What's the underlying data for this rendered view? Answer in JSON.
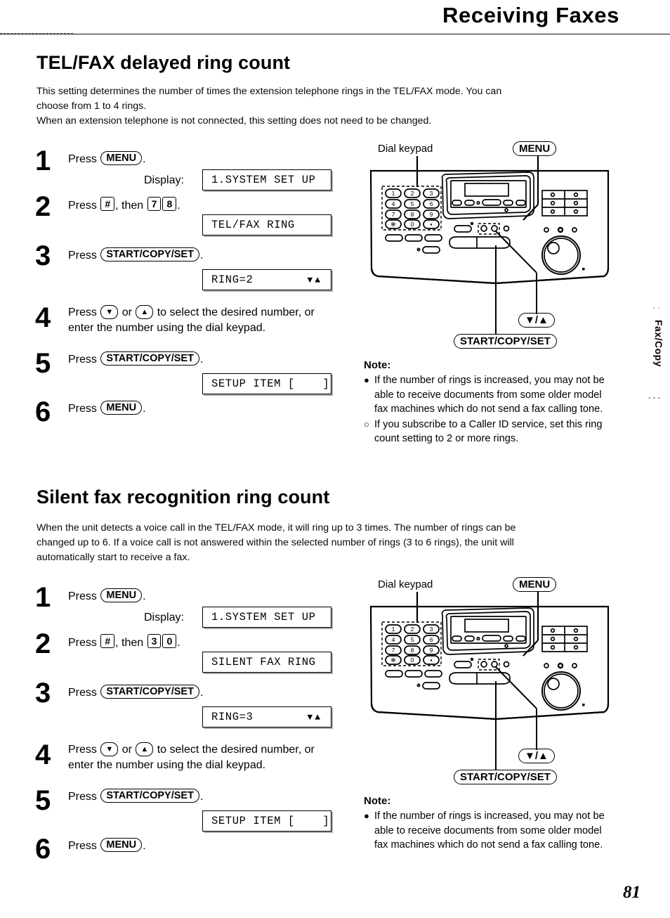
{
  "header": {
    "title": "Receiving Faxes"
  },
  "page_number": "81",
  "side_tab": "Fax/Copy",
  "sections": [
    {
      "title": "TEL/FAX delayed ring count",
      "body": "This setting determines the number of times the extension telephone rings in the TEL/FAX mode. You can choose from 1 to 4 rings.\nWhen an extension telephone is not connected, this setting does not need to be changed.",
      "body_line1": "This setting determines the number of times the extension telephone rings in the TEL/FAX mode. You can",
      "body_line2": "choose from 1 to 4 rings.",
      "body_line3": "When an extension telephone is not connected, this setting does not need to be changed.",
      "steps": [
        {
          "num": "1",
          "press_label": "Press",
          "key": "MENU",
          "suffix": "."
        },
        {
          "num": "2",
          "press_label": "Press",
          "key": "#",
          "mid": ", then",
          "key2": "7",
          "key3": "8",
          "suffix": "."
        },
        {
          "num": "3",
          "press_label": "Press",
          "key": "START/COPY/SET",
          "suffix": "."
        },
        {
          "num": "4",
          "press_label": "Press",
          "key": "▼",
          "mid": "or",
          "key2": "▲",
          "text_after": "to select the desired number, or",
          "text_line2": "enter the number using the dial keypad."
        },
        {
          "num": "5",
          "press_label": "Press",
          "key": "START/COPY/SET",
          "suffix": "."
        },
        {
          "num": "6",
          "press_label": "Press",
          "key": "MENU",
          "suffix": "."
        }
      ],
      "display_label": "Display:",
      "lcds": [
        {
          "text": "1.SYSTEM SET UP",
          "right": ""
        },
        {
          "text": "TEL/FAX RING",
          "right": ""
        },
        {
          "text": "RING=2",
          "right": "▼▲"
        },
        {
          "text": "SETUP ITEM [    ]",
          "right": ""
        }
      ],
      "diagram": {
        "keypad_label": "Dial keypad",
        "menu_label": "MENU",
        "arrows_label_down": "▼",
        "arrows_label_sep": "/",
        "arrows_label_up": "▲",
        "start_label": "START/COPY/SET",
        "keypad_keys": [
          "1",
          "2",
          "3",
          "4",
          "5",
          "6",
          "7",
          "8",
          "9",
          "∗",
          "0",
          "■"
        ]
      },
      "note": {
        "head": "Note:",
        "items": [
          "If the number of rings is increased, you may not be able to receive documents from some older model fax machines which do not send a fax calling tone.",
          "If you subscribe to a Caller ID service, set this ring count setting to 2 or more rings."
        ],
        "bullets": [
          "●",
          "○"
        ]
      }
    },
    {
      "title": "Silent fax recognition ring count",
      "body_line1": "When the unit detects a voice call in the TEL/FAX mode, it will ring up to 3 times. The number of rings can be",
      "body_line2": "changed up to 6. If a voice call is not answered within the selected number of rings (3 to 6 rings), the unit will",
      "body_line3": "automatically start to receive a fax.",
      "steps": [
        {
          "num": "1",
          "press_label": "Press",
          "key": "MENU",
          "suffix": "."
        },
        {
          "num": "2",
          "press_label": "Press",
          "key": "#",
          "mid": ", then",
          "key2": "3",
          "key3": "0",
          "suffix": "."
        },
        {
          "num": "3",
          "press_label": "Press",
          "key": "START/COPY/SET",
          "suffix": "."
        },
        {
          "num": "4",
          "press_label": "Press",
          "key": "▼",
          "mid": "or",
          "key2": "▲",
          "text_after": "to select the desired number, or",
          "text_line2": "enter the number using the dial keypad."
        },
        {
          "num": "5",
          "press_label": "Press",
          "key": "START/COPY/SET",
          "suffix": "."
        },
        {
          "num": "6",
          "press_label": "Press",
          "key": "MENU",
          "suffix": "."
        }
      ],
      "display_label": "Display:",
      "lcds": [
        {
          "text": "1.SYSTEM SET UP",
          "right": ""
        },
        {
          "text": "SILENT FAX RING",
          "right": ""
        },
        {
          "text": "RING=3",
          "right": "▼▲"
        },
        {
          "text": "SETUP ITEM [    ]",
          "right": ""
        }
      ],
      "diagram": {
        "keypad_label": "Dial keypad",
        "menu_label": "MENU",
        "arrows_label_down": "▼",
        "arrows_label_sep": "/",
        "arrows_label_up": "▲",
        "start_label": "START/COPY/SET",
        "keypad_keys": [
          "1",
          "2",
          "3",
          "4",
          "5",
          "6",
          "7",
          "8",
          "9",
          "∗",
          "0",
          "■"
        ]
      },
      "note": {
        "head": "Note:",
        "items": [
          "If the number of rings is increased, you may not be able to receive documents from some older model fax machines which do not send a fax calling tone."
        ],
        "bullets": [
          "●"
        ]
      }
    }
  ]
}
